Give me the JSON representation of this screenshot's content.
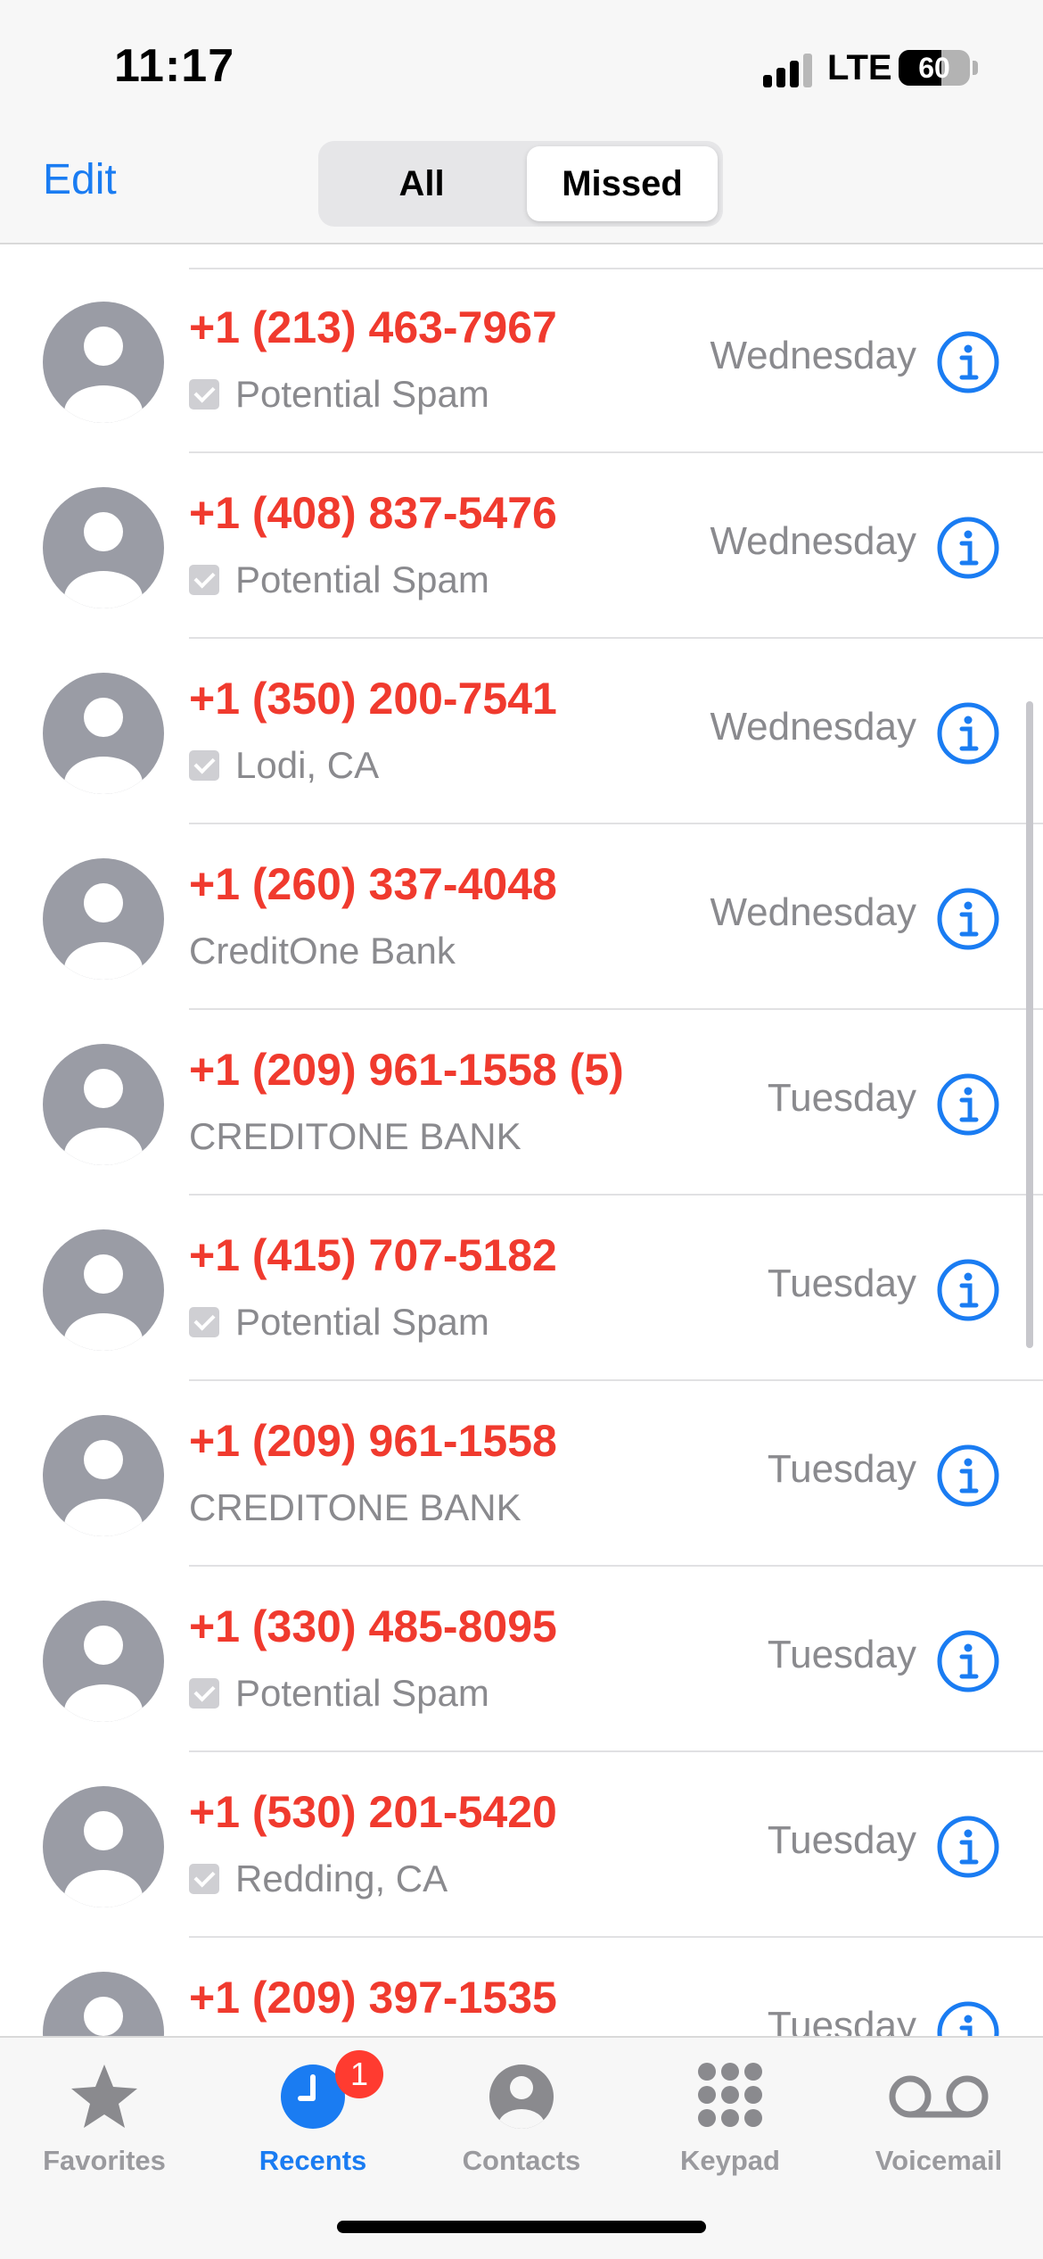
{
  "status_bar": {
    "time": "11:17",
    "network": "LTE",
    "battery_percent": "60",
    "signal_bars_filled": 3,
    "signal_bars_total": 4
  },
  "nav": {
    "edit_label": "Edit",
    "segments": [
      "All",
      "Missed"
    ],
    "selected_segment": "Missed"
  },
  "calls": [
    {
      "number": "+1 (213) 463-7967",
      "sub": "Potential Spam",
      "verified": true,
      "day": "Wednesday"
    },
    {
      "number": "+1 (408) 837-5476",
      "sub": "Potential Spam",
      "verified": true,
      "day": "Wednesday"
    },
    {
      "number": "+1 (350) 200-7541",
      "sub": "Lodi, CA",
      "verified": true,
      "day": "Wednesday"
    },
    {
      "number": "+1 (260) 337-4048",
      "sub": "CreditOne Bank",
      "verified": false,
      "day": "Wednesday"
    },
    {
      "number": "+1 (209) 961-1558 (5)",
      "sub": "CREDITONE BANK",
      "verified": false,
      "day": "Tuesday"
    },
    {
      "number": "+1 (415) 707-5182",
      "sub": "Potential Spam",
      "verified": true,
      "day": "Tuesday"
    },
    {
      "number": "+1 (209) 961-1558",
      "sub": "CREDITONE BANK",
      "verified": false,
      "day": "Tuesday"
    },
    {
      "number": "+1 (330) 485-8095",
      "sub": "Potential Spam",
      "verified": true,
      "day": "Tuesday"
    },
    {
      "number": "+1 (530) 201-5420",
      "sub": "Redding, CA",
      "verified": true,
      "day": "Tuesday"
    },
    {
      "number": "+1 (209) 397-1535",
      "sub": "",
      "verified": false,
      "day": "Tuesday"
    }
  ],
  "tabs": [
    {
      "label": "Favorites",
      "icon": "star-icon",
      "active": false
    },
    {
      "label": "Recents",
      "icon": "clock-icon",
      "active": true,
      "badge": "1"
    },
    {
      "label": "Contacts",
      "icon": "person-circle-icon",
      "active": false
    },
    {
      "label": "Keypad",
      "icon": "keypad-icon",
      "active": false
    },
    {
      "label": "Voicemail",
      "icon": "voicemail-icon",
      "active": false
    }
  ],
  "colors": {
    "missed_red": "#f03a2e",
    "accent_blue": "#1a7cf2",
    "secondary_gray": "#8a8a8e",
    "badge_red": "#ff3b30"
  }
}
